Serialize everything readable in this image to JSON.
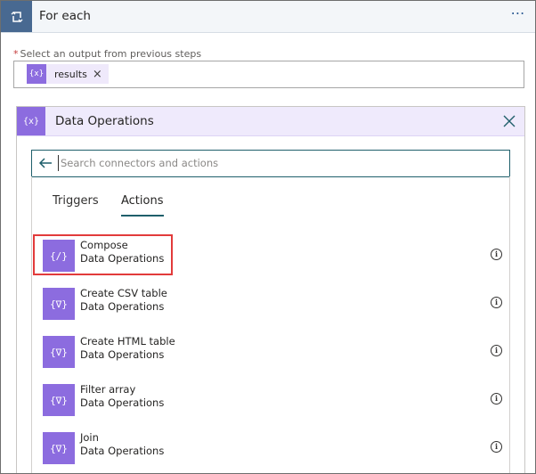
{
  "header": {
    "title": "For each",
    "more_label": "⋯"
  },
  "select_output": {
    "required_mark": "*",
    "label": "Select an output from previous steps",
    "token": {
      "icon_text": "{x}",
      "label": "results",
      "close": "×"
    }
  },
  "panel": {
    "icon_text": "{x}",
    "title": "Data Operations",
    "search": {
      "placeholder": "Search connectors and actions",
      "value": ""
    },
    "tabs": [
      {
        "label": "Triggers",
        "selected": false
      },
      {
        "label": "Actions",
        "selected": true
      }
    ],
    "items": [
      {
        "name": "Compose",
        "connector": "Data Operations",
        "icon_text": "{∕}",
        "highlighted": true
      },
      {
        "name": "Create CSV table",
        "connector": "Data Operations",
        "icon_text": "{∇}",
        "highlighted": false
      },
      {
        "name": "Create HTML table",
        "connector": "Data Operations",
        "icon_text": "{∇}",
        "highlighted": false
      },
      {
        "name": "Filter array",
        "connector": "Data Operations",
        "icon_text": "{∇}",
        "highlighted": false
      },
      {
        "name": "Join",
        "connector": "Data Operations",
        "icon_text": "{∇}",
        "highlighted": false
      }
    ],
    "info_glyph": "i"
  },
  "colors": {
    "loop_accent": "#486991",
    "data_ops_accent": "#8c6cdf",
    "highlight": "#e23b3b",
    "tab_underline": "#1f5f6b"
  }
}
